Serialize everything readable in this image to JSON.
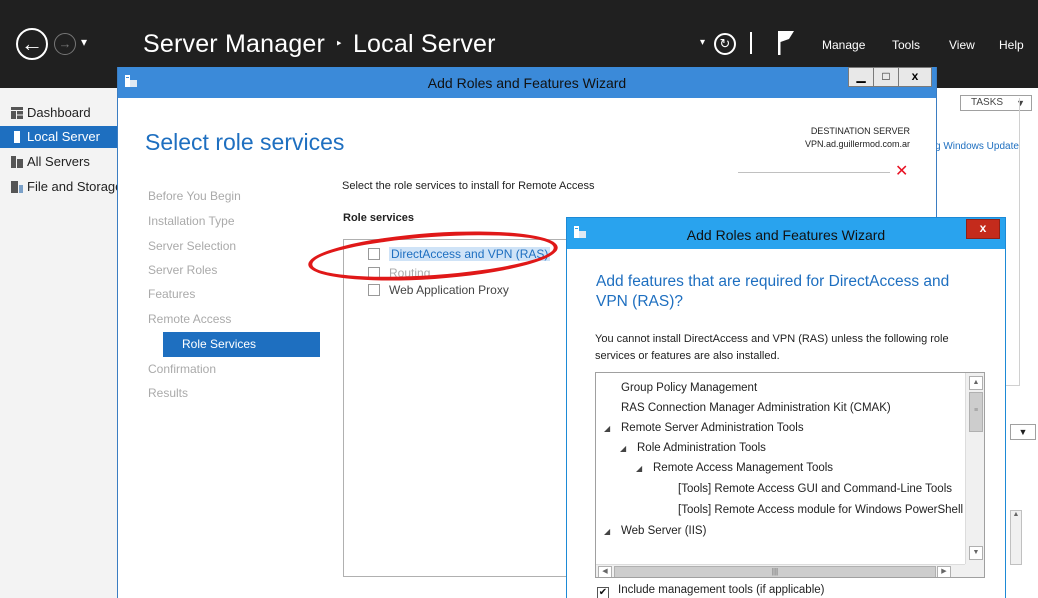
{
  "server_manager": {
    "title": "Server Manager",
    "breadcrumb_sep": "‣",
    "breadcrumb_current": "Local Server",
    "menu": [
      "Manage",
      "Tools",
      "View",
      "Help"
    ],
    "sidebar": [
      {
        "label": "Dashboard",
        "active": false
      },
      {
        "label": "Local Server",
        "active": true
      },
      {
        "label": "All Servers",
        "active": false
      },
      {
        "label": "File and Storage Services",
        "active": false
      }
    ],
    "tasks_label": "TASKS",
    "windows_update_link": "g Windows Update"
  },
  "wizard": {
    "title": "Add Roles and Features Wizard",
    "page_title": "Select role services",
    "destination_label": "DESTINATION SERVER",
    "destination_server": "VPN.ad.guillermod.com.ar",
    "steps": [
      {
        "label": "Before You Begin",
        "active": false
      },
      {
        "label": "Installation Type",
        "active": false
      },
      {
        "label": "Server Selection",
        "active": false
      },
      {
        "label": "Server Roles",
        "active": false
      },
      {
        "label": "Features",
        "active": false
      },
      {
        "label": "Remote Access",
        "active": false
      },
      {
        "label": "Role Services",
        "active": true
      },
      {
        "label": "Confirmation",
        "active": false
      },
      {
        "label": "Results",
        "active": false
      }
    ],
    "instruction": "Select the role services to install for Remote Access",
    "role_services_header": "Role services",
    "role_services": [
      {
        "label": "DirectAccess and VPN (RAS)",
        "checked": false,
        "selected": true
      },
      {
        "label": "Routing",
        "checked": false,
        "selected": false
      },
      {
        "label": "Web Application Proxy",
        "checked": false,
        "selected": false
      }
    ]
  },
  "dialog": {
    "title": "Add Roles and Features Wizard",
    "question": "Add features that are required for DirectAccess and VPN (RAS)?",
    "info": "You cannot install DirectAccess and VPN (RAS) unless the following role services or features are also installed.",
    "features": [
      {
        "label": "Group Policy Management",
        "level": 0,
        "expander": false
      },
      {
        "label": "RAS Connection Manager Administration Kit (CMAK)",
        "level": 0,
        "expander": false
      },
      {
        "label": "Remote Server Administration Tools",
        "level": 0,
        "expander": true
      },
      {
        "label": "Role Administration Tools",
        "level": 1,
        "expander": true
      },
      {
        "label": "Remote Access Management Tools",
        "level": 2,
        "expander": true
      },
      {
        "label": "[Tools] Remote Access GUI and Command-Line Tools",
        "level": 3,
        "expander": false
      },
      {
        "label": "[Tools] Remote Access module for Windows PowerShell",
        "level": 3,
        "expander": false
      },
      {
        "label": "Web Server (IIS)",
        "level": 0,
        "expander": true
      }
    ],
    "include_mgmt_label": "Include management tools (if applicable)",
    "include_mgmt_checked": true
  }
}
